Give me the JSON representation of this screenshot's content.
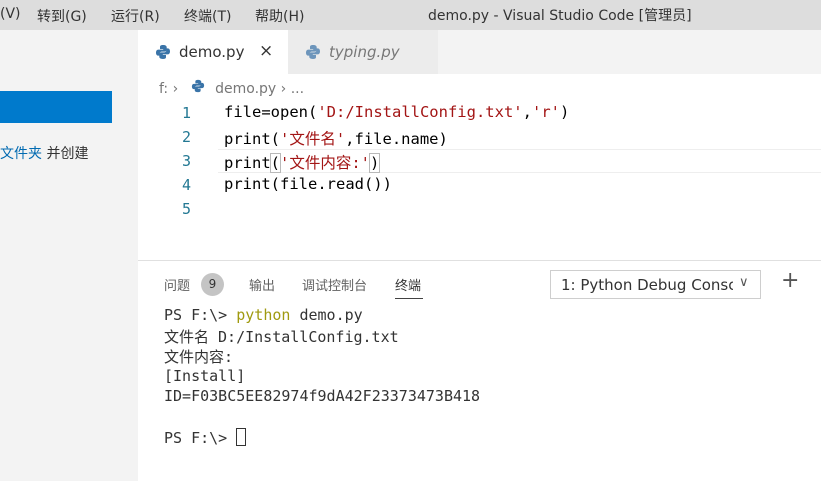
{
  "menu": [
    "(V)",
    "转到(G)",
    "运行(R)",
    "终端(T)",
    "帮助(H)"
  ],
  "window_title": "demo.py - Visual Studio Code [管理员]",
  "sidebar": {
    "text_link": "文件夹",
    "text_rest": "并创建"
  },
  "tabs": [
    {
      "label": "demo.py",
      "icon": "python-icon",
      "active": true
    },
    {
      "label": "typing.py",
      "icon": "python-icon",
      "active": false,
      "preview": true
    }
  ],
  "tab_close": "×",
  "breadcrumb": {
    "drive": "f:",
    "file": "demo.py",
    "more": "..."
  },
  "editor": {
    "line_numbers": [
      "1",
      "2",
      "3",
      "4",
      "5"
    ],
    "lines": [
      {
        "a": "file=open(",
        "s": "'D:/InstallConfig.txt'",
        "b": ",",
        "s2": "'r'",
        "c": ")"
      },
      {
        "a": "print(",
        "s": "'文件名'",
        "b": ",file.name)"
      },
      {
        "a": "print",
        "s": "'文件内容:'"
      },
      {
        "a": "print(file.read())"
      }
    ]
  },
  "panel": {
    "tabs": [
      "问题",
      "输出",
      "调试控制台",
      "终端"
    ],
    "problems_count": "9",
    "terminal_select": "1: Python Debug Consc",
    "add_icon": "+"
  },
  "terminal": {
    "prompt": "PS F:\\> ",
    "cmd_python": "python",
    "cmd_rest": " demo.py",
    "out": [
      "文件名 D:/InstallConfig.txt",
      "文件内容:",
      "[Install]",
      "ID=F03BC5EE82974f9dA42F23373473B418"
    ],
    "prompt2": "PS F:\\> "
  },
  "colors": {
    "accent": "#007acc",
    "string": "#a31515",
    "line_number": "#237893",
    "python_cmd": "#a09a10"
  }
}
